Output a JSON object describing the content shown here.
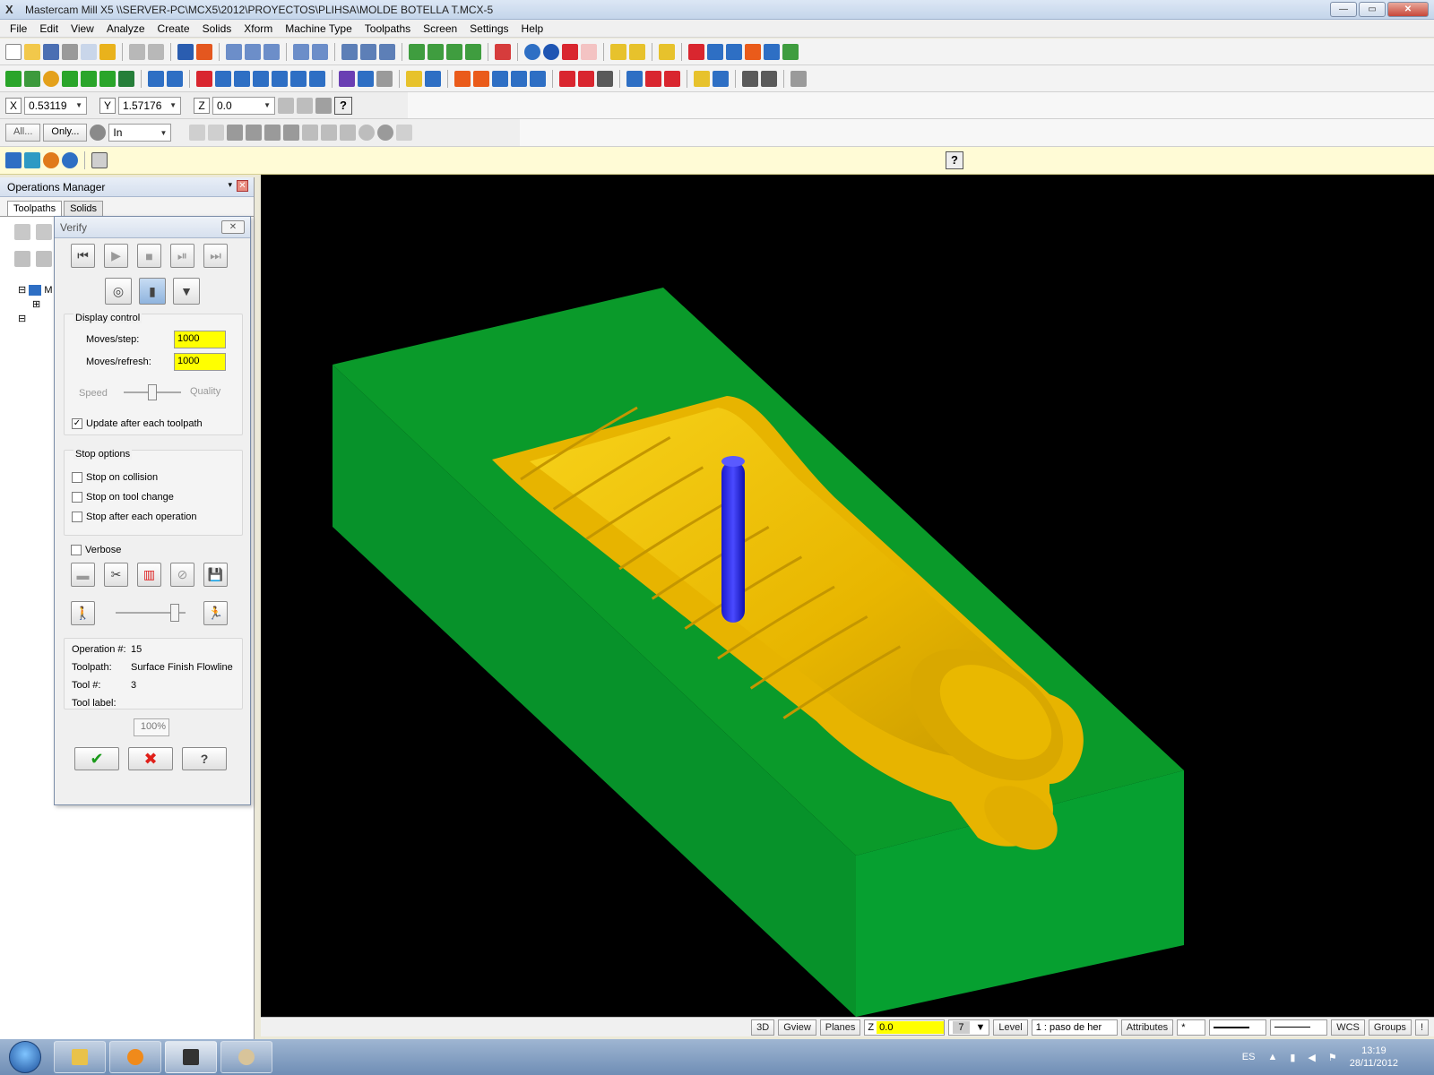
{
  "window": {
    "title": "Mastercam Mill X5  \\\\SERVER-PC\\MCX5\\2012\\PROYECTOS\\PLIHSA\\MOLDE BOTELLA T.MCX-5",
    "logo_text": "X",
    "btn_min": "—",
    "btn_max": "▭",
    "btn_close": "✕"
  },
  "menu": [
    "File",
    "Edit",
    "View",
    "Analyze",
    "Create",
    "Solids",
    "Xform",
    "Machine Type",
    "Toolpaths",
    "Screen",
    "Settings",
    "Help"
  ],
  "coords": {
    "x_label": "X",
    "x_value": "0.53119",
    "y_label": "Y",
    "y_value": "1.57176",
    "z_label": "Z",
    "z_value": "0.0"
  },
  "selection_bar": {
    "all_label": "All...",
    "only_label": "Only...",
    "mode_value": "In"
  },
  "help_glyph": "?",
  "ops_manager": {
    "title": "Operations Manager",
    "tab_toolpaths": "Toolpaths",
    "tab_solids": "Solids",
    "pin_glyph": "▾",
    "close_glyph": "✕",
    "tree_prefix": "M"
  },
  "verify": {
    "title": "Verify",
    "close_glyph": "✕",
    "display_control_label": "Display control",
    "moves_step_label": "Moves/step:",
    "moves_step_value": "1000",
    "moves_refresh_label": "Moves/refresh:",
    "moves_refresh_value": "1000",
    "speed_label": "Speed",
    "quality_label": "Quality",
    "speed_quality_level": 0.5,
    "update_label": "Update after each toolpath",
    "update_checked": "✓",
    "stop_options_label": "Stop options",
    "stop_collision_label": "Stop on collision",
    "stop_tool_change_label": "Stop on tool change",
    "stop_each_op_label": "Stop after each operation",
    "verbose_label": "Verbose",
    "playback_speed_level": 0.85,
    "operation_label": "Operation #:",
    "operation_value": "15",
    "toolpath_label": "Toolpath:",
    "toolpath_value": "Surface Finish Flowline",
    "tool_label": "Tool #:",
    "tool_value": "3",
    "tool_label_label": "Tool label:",
    "tool_label_value": "",
    "progress_text": "100%",
    "ok_glyph": "✔",
    "cancel_glyph": "✖",
    "help_glyph": "?"
  },
  "statusbar": {
    "view_3d": "3D",
    "gview": "Gview",
    "planes": "Planes",
    "z_label": "Z",
    "z_value": "0.0",
    "color_value": "7",
    "level_label": "Level",
    "level_value": "1 : paso de her",
    "attributes": "Attributes",
    "point_style": "*",
    "wcs": "WCS",
    "groups": "Groups",
    "bang": "!"
  },
  "taskbar": {
    "lang": "ES",
    "time": "13:19",
    "date": "28/11/2012"
  },
  "colors": {
    "stock": "#0a9a2a",
    "part": "#f2c200",
    "tool": "#2222ee",
    "viewport_bg": "#000000"
  }
}
